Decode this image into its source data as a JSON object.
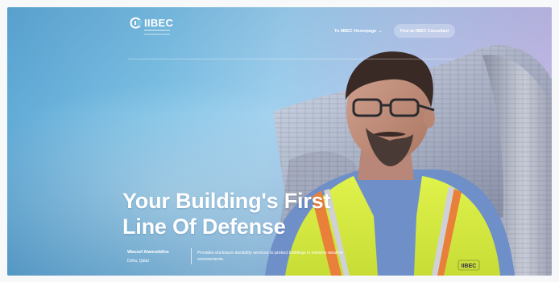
{
  "header": {
    "logo_text": "IIBEC",
    "nav_link": "To IIBEC Homepage",
    "cta_button": "Find an IIBEC Consultant"
  },
  "hero": {
    "headline_line1": "Your Building's First",
    "headline_line2": "Line Of Defense",
    "person_name": "Wassef Alamoddine",
    "person_location": "Doha, Qatar",
    "tagline": "Provides enclosure durability services to protect buildings in extreme weather environments.",
    "vest_badge": "IIBEC"
  },
  "icons": [
    "iibec-logo-icon",
    "chevron-down-icon"
  ],
  "colors": {
    "background_left": "#5ea9d6",
    "background_right": "#c7b5e4",
    "vest_yellow": "#d7f03c",
    "vest_orange": "#e9803a",
    "shirt_blue": "#6f8fc8",
    "text": "#ffffff"
  }
}
